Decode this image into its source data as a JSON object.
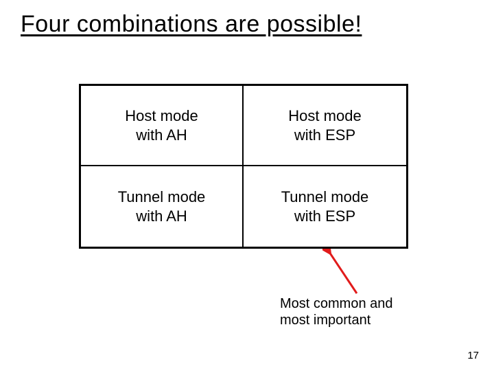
{
  "title": "Four combinations are possible!",
  "cells": {
    "tl": {
      "line1": "Host mode",
      "line2": "with AH"
    },
    "tr": {
      "line1": "Host mode",
      "line2": "with ESP"
    },
    "bl": {
      "line1": "Tunnel mode",
      "line2": "with AH"
    },
    "br": {
      "line1": "Tunnel mode",
      "line2": "with ESP"
    }
  },
  "caption": {
    "line1": "Most common and",
    "line2": "most important"
  },
  "page_number": "17",
  "arrow_color": "#e11b1b"
}
